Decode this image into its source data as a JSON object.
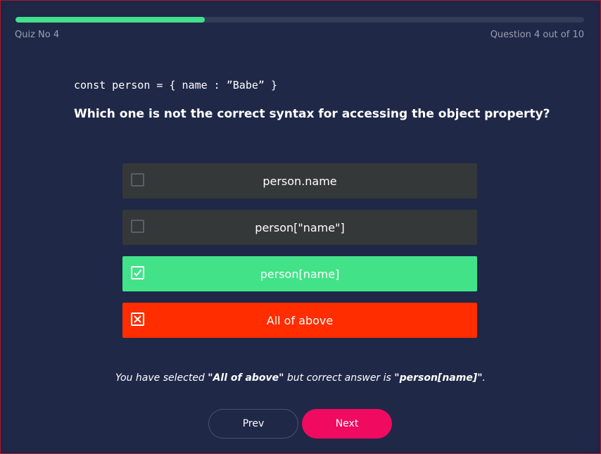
{
  "progress": {
    "fraction": 0.333,
    "color": "#42e08c"
  },
  "header": {
    "quiz_label": "Quiz No 4",
    "question_count": "Question 4 out of 10"
  },
  "question": {
    "code": "const person = { name : ”Babe” }",
    "text": "Which one is not the correct syntax for accessing the object property?"
  },
  "options": [
    {
      "label": "person.name",
      "state": "unselected"
    },
    {
      "label": "person[\"name\"]",
      "state": "unselected"
    },
    {
      "label": "person[name]",
      "state": "correct",
      "icon": "check-icon"
    },
    {
      "label": "All of above",
      "state": "wrong",
      "icon": "x-icon"
    }
  ],
  "feedback": {
    "prefix": "You have selected ",
    "selected": "\"All of above\"",
    "middle": " but correct answer is ",
    "correct": "\"person[name]\"",
    "suffix": "."
  },
  "buttons": {
    "prev": "Prev",
    "next": "Next"
  },
  "colors": {
    "correct": "#42e388",
    "wrong": "#ff2d00",
    "next_button": "#f00a60",
    "background": "#1f2847"
  }
}
